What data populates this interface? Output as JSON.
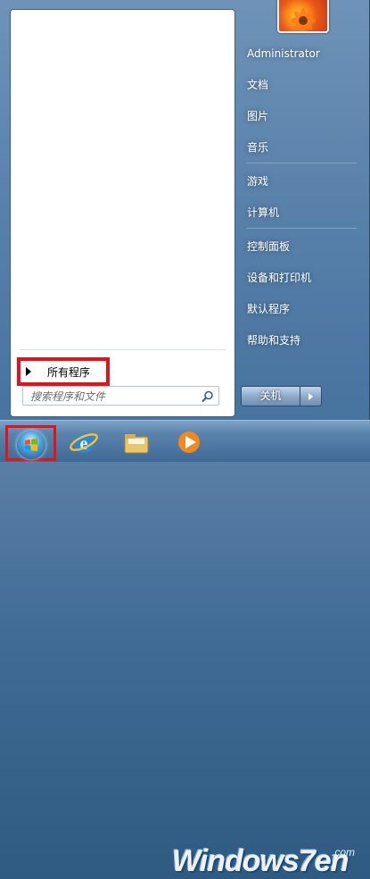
{
  "start_menu": {
    "all_programs_label": "所有程序",
    "search_placeholder": "搜索程序和文件",
    "user_name": "Administrator",
    "right_items": [
      {
        "label": "文档"
      },
      {
        "label": "图片"
      },
      {
        "label": "音乐"
      },
      {
        "label": "游戏"
      },
      {
        "label": "计算机"
      },
      {
        "label": "控制面板"
      },
      {
        "label": "设备和打印机"
      },
      {
        "label": "默认程序"
      },
      {
        "label": "帮助和支持"
      }
    ],
    "shutdown_label": "关机"
  },
  "taskbar": {
    "watermark_text": "Windows7en",
    "watermark_sub": ".com",
    "pinned": [
      "internet-explorer-icon",
      "file-explorer-icon",
      "media-player-icon"
    ]
  },
  "colors": {
    "highlight_box": "#e0141b",
    "menu_blue": "#5a82ab"
  }
}
